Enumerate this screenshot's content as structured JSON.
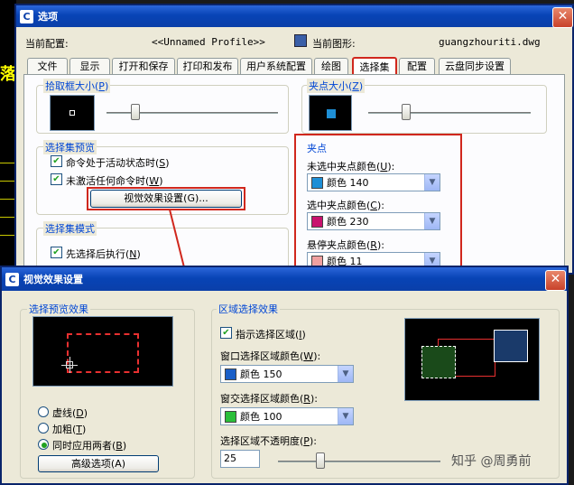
{
  "main_dialog": {
    "title": "选项",
    "current_config_label": "当前配置:",
    "current_config_value": "<<Unnamed Profile>>",
    "current_drawing_label": "当前图形:",
    "current_drawing_value": "guangzhouriti.dwg",
    "tabs": [
      "文件",
      "显示",
      "打开和保存",
      "打印和发布",
      "用户系统配置",
      "绘图",
      "选择集",
      "配置",
      "云盘同步设置"
    ],
    "pickbox_group": "拾取框大小",
    "pickbox_key": "P",
    "grip_size_group": "夹点大小",
    "grip_size_key": "Z",
    "sel_preview_group": "选择集预览",
    "chk_active_cmd": "命令处于活动状态时",
    "chk_active_cmd_key": "S",
    "chk_no_cmd": "未激活任何命令时",
    "chk_no_cmd_key": "W",
    "visual_effects_btn": "视觉效果设置(G)...",
    "sel_mode_group": "选择集模式",
    "chk_noun_verb": "先选择后执行",
    "chk_noun_verb_key": "N",
    "grips_group": "夹点",
    "unselected_grip_label": "未选中夹点颜色",
    "unselected_grip_key": "U",
    "unselected_grip_value": "颜色 140",
    "unselected_grip_color": "#1e8fd6",
    "selected_grip_label": "选中夹点颜色",
    "selected_grip_key": "C",
    "selected_grip_value": "颜色 230",
    "selected_grip_color": "#c8126e",
    "hover_grip_label": "悬停夹点颜色",
    "hover_grip_key": "R",
    "hover_grip_value": "颜色 11",
    "hover_grip_color": "#f0a0a0"
  },
  "visual_dialog": {
    "title": "视觉效果设置",
    "sel_preview_effect_group": "选择预览效果",
    "radio_dashed": "虚线",
    "radio_dashed_key": "D",
    "radio_thicken": "加粗",
    "radio_thicken_key": "T",
    "radio_both": "同时应用两者",
    "radio_both_key": "B",
    "advanced_btn": "高级选项(A)",
    "area_effect_group": "区域选择效果",
    "chk_indicate_area": "指示选择区域",
    "chk_indicate_area_key": "I",
    "window_color_label": "窗口选择区域颜色",
    "window_color_key": "W",
    "window_color_value": "颜色 150",
    "window_color": "#1a5fc8",
    "crossing_color_label": "窗交选择区域颜色",
    "crossing_color_key": "R",
    "crossing_color_value": "颜色 100",
    "crossing_color": "#2bbf3a",
    "opacity_label": "选择区域不透明度",
    "opacity_key": "P",
    "opacity_value": "25"
  },
  "watermark": "知乎 @周勇前"
}
